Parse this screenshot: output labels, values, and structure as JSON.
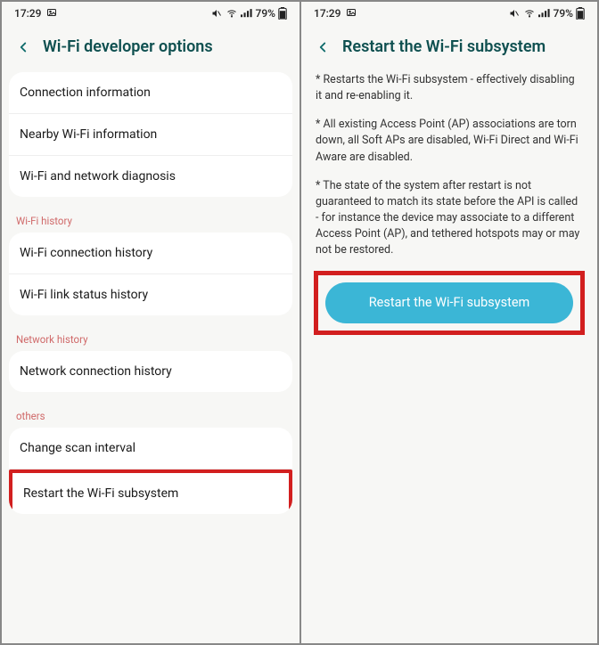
{
  "status": {
    "time": "17:29",
    "battery_pct": "79%"
  },
  "left": {
    "title": "Wi-Fi developer options",
    "groups": [
      {
        "header": null,
        "items": [
          "Connection information",
          "Nearby Wi-Fi information",
          "Wi-Fi and network diagnosis"
        ]
      },
      {
        "header": "Wi-Fi history",
        "items": [
          "Wi-Fi connection history",
          "Wi-Fi link status history"
        ]
      },
      {
        "header": "Network history",
        "items": [
          "Network connection history"
        ]
      },
      {
        "header": "others",
        "items": [
          "Change scan interval",
          "Restart the Wi-Fi subsystem"
        ]
      }
    ]
  },
  "right": {
    "title": "Restart the Wi-Fi subsystem",
    "paragraphs": [
      "* Restarts the Wi-Fi subsystem - effectively disabling it and re-enabling it.",
      "* All existing Access Point (AP) associations are torn down, all Soft APs are disabled, Wi-Fi Direct and Wi-Fi Aware are disabled.",
      "* The state of the system after restart is not guaranteed to match its state before the API is called - for instance the device may associate to a different Access Point (AP), and tethered hotspots may or may not be restored."
    ],
    "button": "Restart the Wi-Fi subsystem"
  }
}
